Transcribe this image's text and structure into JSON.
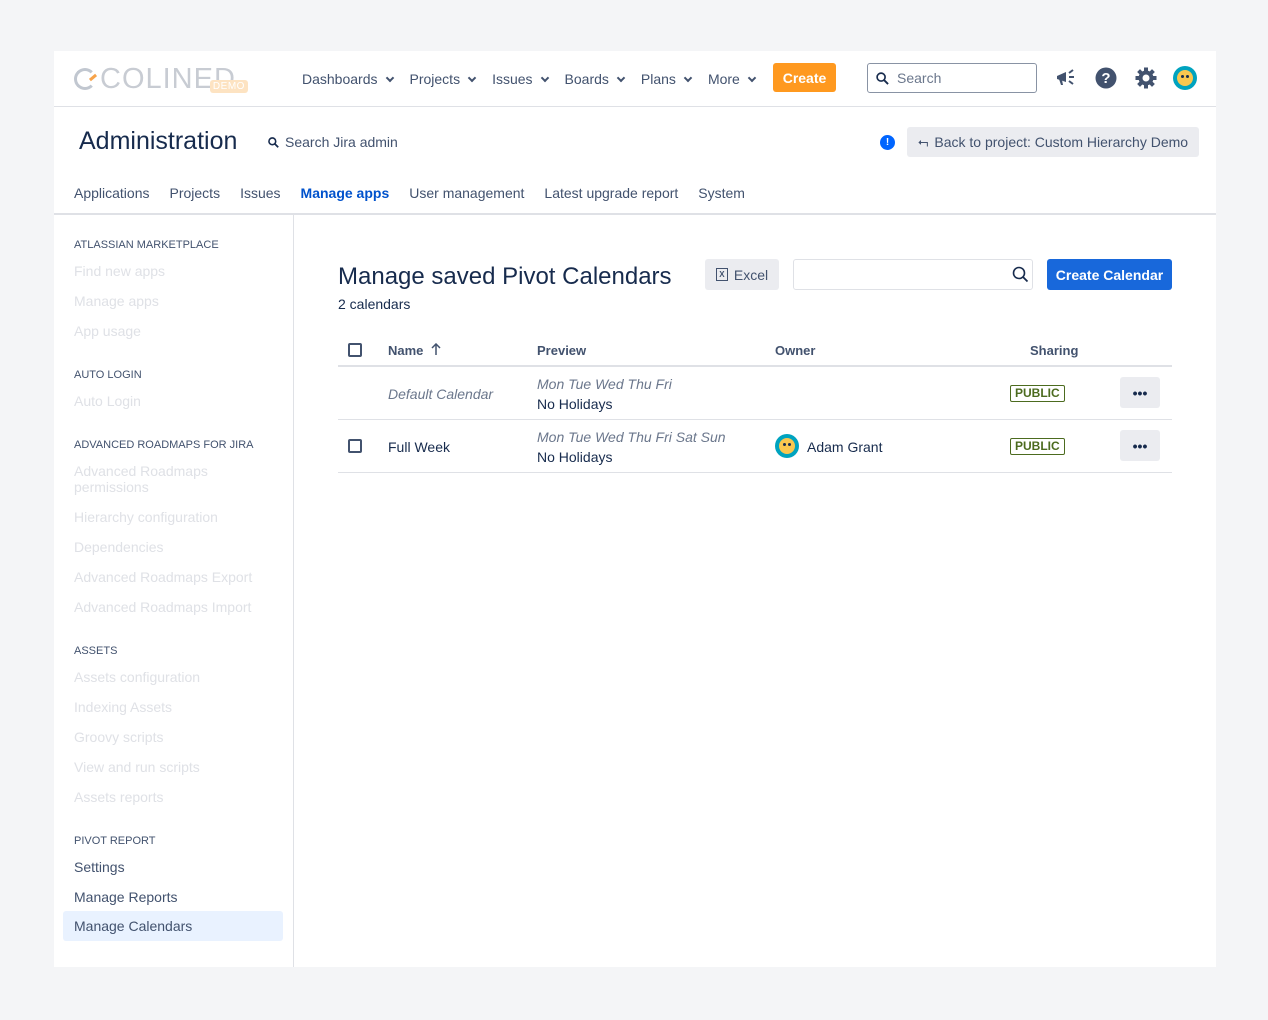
{
  "topnav": {
    "logo_text": "COLINED",
    "logo_badge": "DEMO",
    "items": [
      {
        "label": "Dashboards"
      },
      {
        "label": "Projects"
      },
      {
        "label": "Issues"
      },
      {
        "label": "Boards"
      },
      {
        "label": "Plans"
      },
      {
        "label": "More"
      }
    ],
    "create_label": "Create",
    "search_placeholder": "Search",
    "icons": [
      "megaphone-icon",
      "help-icon",
      "settings-icon",
      "user-avatar"
    ]
  },
  "admin": {
    "title": "Administration",
    "search_label": "Search Jira admin",
    "back_label": "Back to project: Custom Hierarchy Demo",
    "tabs": [
      {
        "label": "Applications"
      },
      {
        "label": "Projects"
      },
      {
        "label": "Issues"
      },
      {
        "label": "Manage apps",
        "active": true
      },
      {
        "label": "User management"
      },
      {
        "label": "Latest upgrade report"
      },
      {
        "label": "System"
      }
    ]
  },
  "sidebar": {
    "sections": [
      {
        "title": "ATLASSIAN MARKETPLACE",
        "items": [
          "Find new apps",
          "Manage apps",
          "App usage"
        ]
      },
      {
        "title": "AUTO LOGIN",
        "items": [
          "Auto Login"
        ]
      },
      {
        "title": "ADVANCED ROADMAPS FOR JIRA",
        "items": [
          "Advanced Roadmaps permissions",
          "Hierarchy configuration",
          "Dependencies",
          "Advanced Roadmaps Export",
          "Advanced Roadmaps Import"
        ]
      },
      {
        "title": "ASSETS",
        "items": [
          "Assets configuration",
          "Indexing Assets",
          "Groovy scripts",
          "View and run scripts",
          "Assets reports"
        ]
      },
      {
        "title": "PIVOT REPORT",
        "items": [
          "Settings",
          "Manage Reports",
          "Manage Calendars"
        ],
        "selected": "Manage Calendars"
      }
    ]
  },
  "main": {
    "title": "Manage saved Pivot Calendars",
    "count": "2 calendars",
    "excel_label": "Excel",
    "filter_value": "",
    "create_label": "Create Calendar",
    "columns": {
      "name": "Name",
      "preview": "Preview",
      "owner": "Owner",
      "sharing": "Sharing"
    },
    "rows": [
      {
        "name": "Default Calendar",
        "days": "Mon Tue Wed Thu Fri",
        "holidays": "No Holidays",
        "owner": "",
        "sharing": "PUBLIC",
        "default": true
      },
      {
        "name": "Full Week",
        "days": "Mon Tue Wed Thu Fri Sat Sun",
        "holidays": "No Holidays",
        "owner": "Adam Grant",
        "sharing": "PUBLIC",
        "default": false
      }
    ],
    "more_label": "•••"
  },
  "colors": {
    "create": "#ff991f",
    "primary": "#1868db",
    "active_tab": "#0052cc",
    "lozenge": "#4c6b1f"
  }
}
